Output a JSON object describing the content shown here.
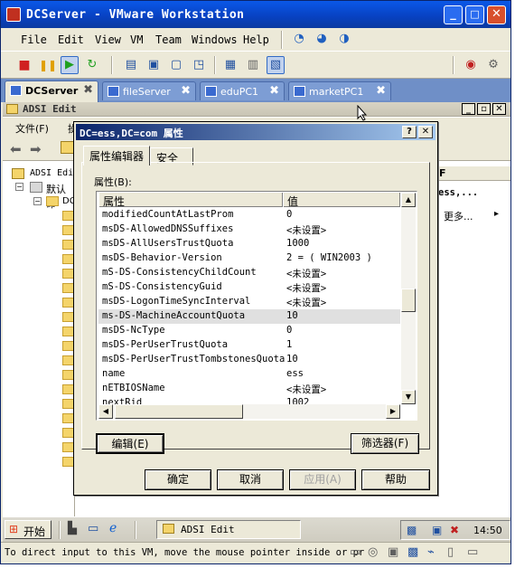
{
  "window": {
    "title": "DCServer - VMware Workstation",
    "min": "_",
    "max": "□",
    "close": "✕"
  },
  "menu": [
    "File",
    "Edit",
    "View",
    "VM",
    "Team",
    "Windows",
    "Help"
  ],
  "tabs": [
    {
      "label": "DCServer",
      "close": "✖"
    },
    {
      "label": "fileServer",
      "close": "✖"
    },
    {
      "label": "eduPC1",
      "close": "✖"
    },
    {
      "label": "marketPC1",
      "close": "✖"
    }
  ],
  "adsi": {
    "title": "ADSI Edit",
    "menu": [
      "文件(F)",
      "操"
    ],
    "tree": {
      "root": "ADSI Edi",
      "child": "默认命",
      "dc": "DC"
    },
    "actions": {
      "header": "F",
      "item": "ess,...",
      "more": "更多...",
      "arrow": "▸"
    }
  },
  "dialog": {
    "title": "DC=ess,DC=com 属性",
    "help": "?",
    "close": "✕",
    "tabs": [
      "属性编辑器",
      "安全"
    ],
    "attributes_label": "属性(B):",
    "columns": [
      "属性",
      "值"
    ],
    "rows": [
      {
        "name": "modifiedCountAtLastProm",
        "value": "0"
      },
      {
        "name": "msDS-AllowedDNSSuffixes",
        "value": "<未设置>"
      },
      {
        "name": "msDS-AllUsersTrustQuota",
        "value": "1000"
      },
      {
        "name": "msDS-Behavior-Version",
        "value": "2 = ( WIN2003 )"
      },
      {
        "name": "mS-DS-ConsistencyChildCount",
        "value": "<未设置>"
      },
      {
        "name": "mS-DS-ConsistencyGuid",
        "value": "<未设置>"
      },
      {
        "name": "msDS-LogonTimeSyncInterval",
        "value": "<未设置>"
      },
      {
        "name": "ms-DS-MachineAccountQuota",
        "value": "10",
        "selected": true
      },
      {
        "name": "msDS-NcType",
        "value": "0"
      },
      {
        "name": "msDS-PerUserTrustQuota",
        "value": "1"
      },
      {
        "name": "msDS-PerUserTrustTombstonesQuota",
        "value": "10"
      },
      {
        "name": "name",
        "value": "ess"
      },
      {
        "name": "nETBIOSName",
        "value": "<未设置>"
      },
      {
        "name": "nextRid",
        "value": "1002"
      }
    ],
    "edit_button": "编辑(E)",
    "filter_button": "筛选器(F)",
    "ok": "确定",
    "cancel": "取消",
    "apply": "应用(A)",
    "helpbtn": "帮助"
  },
  "taskbar": {
    "start": "开始",
    "task": "ADSI Edit",
    "clock": "14:50"
  },
  "status": {
    "text": "To direct input to this VM, move the mouse pointer inside or pr"
  },
  "colors": {
    "titlebar": "#0a58e8",
    "dialog_title": "#0a246a",
    "tabbar": "#6f8fc7",
    "guest_bg": "#3a6ea5"
  }
}
